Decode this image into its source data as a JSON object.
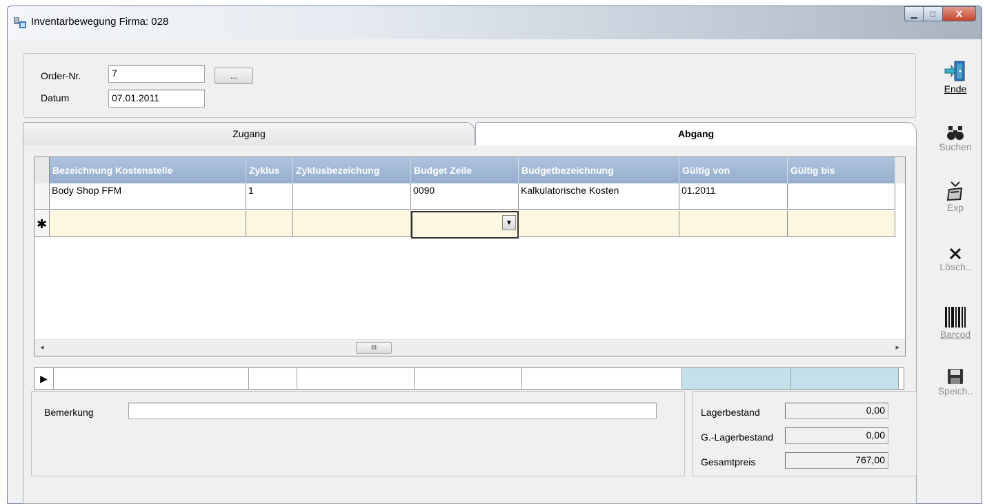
{
  "window": {
    "title": "Inventarbewegung Firma: 028"
  },
  "titlebar_buttons": {
    "minimize": "▁",
    "maximize": "□",
    "close": "X"
  },
  "header": {
    "order_label": "Order-Nr.",
    "order_value": "7",
    "order_lookup": "...",
    "date_label": "Datum",
    "date_value": "07.01.2011"
  },
  "tabs": [
    {
      "label": "Zugang",
      "active": false
    },
    {
      "label": "Abgang",
      "active": true
    }
  ],
  "grid": {
    "columns": [
      "Bezeichnung Kostenstelle",
      "Zyklus",
      "Zyklusbezeichung",
      "Budget Zeile",
      "Budgetbezeichnung",
      "Gültig von",
      "Gültig bis"
    ],
    "rows": [
      [
        "Body Shop FFM",
        "1",
        "",
        "0090",
        "Kalkulatorische Kosten",
        "01.2011",
        ""
      ]
    ],
    "new_row_marker": "✱",
    "current_row_marker": "▶",
    "scroll_thumb": "III",
    "scroll_left": "◂",
    "scroll_right": "▸"
  },
  "remark": {
    "label": "Bemerkung",
    "value": ""
  },
  "totals": {
    "stock_label": "Lagerbestand",
    "stock_value": "0,00",
    "total_stock_label": "G.-Lagerbestand",
    "total_stock_value": "0,00",
    "total_price_label": "Gesamtpreis",
    "total_price_value": "767,00"
  },
  "toolbar": {
    "exit": "Ende",
    "search": "Suchen",
    "export": "Exp",
    "delete": "Lösch..",
    "barcode": "Barcod",
    "save": "Speich.."
  },
  "colors": {
    "grid_header": "#a3b9d5",
    "new_row": "#fbf7e1",
    "summary_highlight": "#c4e1eb",
    "close_button": "#c9503a"
  }
}
